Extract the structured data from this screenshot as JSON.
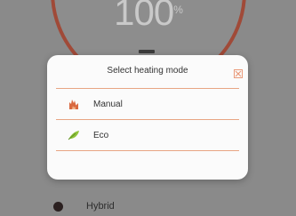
{
  "background": {
    "percent_value": "100",
    "percent_sign": "%",
    "option_label": "Hybrid"
  },
  "modal": {
    "title": "Select heating mode",
    "options": [
      {
        "label": "Manual",
        "icon": "flame-icon",
        "color": "#d9683f"
      },
      {
        "label": "Eco",
        "icon": "leaf-icon",
        "color": "#8fc43a"
      }
    ],
    "accent_color": "#e8a583"
  }
}
